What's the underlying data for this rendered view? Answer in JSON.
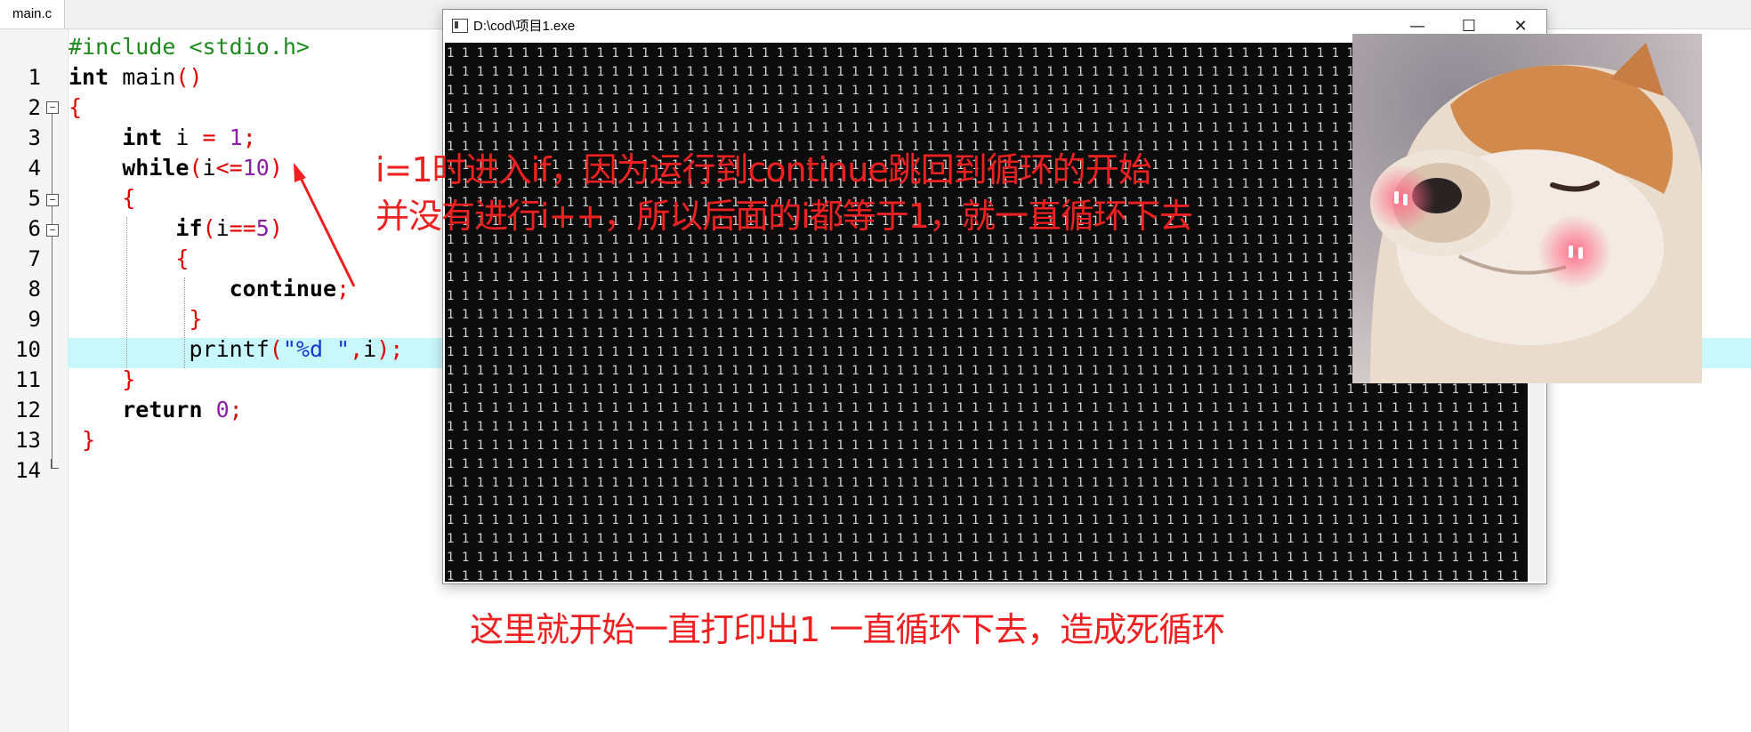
{
  "editor": {
    "tab_label": "main.c",
    "line_numbers": [
      "1",
      "2",
      "3",
      "4",
      "5",
      "6",
      "7",
      "8",
      "9",
      "10",
      "11",
      "12",
      "13",
      "14"
    ],
    "code": {
      "l1_directive": "#include <stdio.h>",
      "l2_type": "int",
      "l2_name": " main",
      "l2_parens": "()",
      "l3_brace": "{",
      "l4_type": "int",
      "l4_var": " i ",
      "l4_eq": "=",
      "l4_num": " 1",
      "l4_semi": ";",
      "l5_kw": "while",
      "l5_open": "(",
      "l5_var": "i",
      "l5_op": "<=",
      "l5_num": "10",
      "l5_close": ")",
      "l6_brace": "{",
      "l7_kw": "if",
      "l7_open": "(",
      "l7_var": "i",
      "l7_op": "==",
      "l7_num": "5",
      "l7_close": ")",
      "l8_brace": "{",
      "l9_kw": "continue",
      "l9_semi": ";",
      "l10_brace": "}",
      "l11_fn": "printf",
      "l11_open": "(",
      "l11_str": "\"%d \"",
      "l11_comma": ",",
      "l11_var": "i",
      "l11_close": ");",
      "l12_brace": "}",
      "l13_kw": "return",
      "l13_num": " 0",
      "l13_semi": ";",
      "l14_brace": "}"
    },
    "highlight_color": "#c8f7fc"
  },
  "console": {
    "title": "D:\\cod\\项目1.exe",
    "minimize_label": "—",
    "maximize_label": "☐",
    "close_label": "✕",
    "output_token": "1",
    "output_description": "repeated '1' characters filling console"
  },
  "annotations": {
    "top_line1": "i=1时进入if，因为运行到continue跳回到循环的开始",
    "top_line2": "并没有进行i++，所以后面的i都等于1，就一直循环下去",
    "bottom": "这里就开始一直打印出1 一直循环下去，造成死循环",
    "color": "#ee2020"
  },
  "meme": {
    "icon": "shiba-dog-blushing-icon"
  }
}
